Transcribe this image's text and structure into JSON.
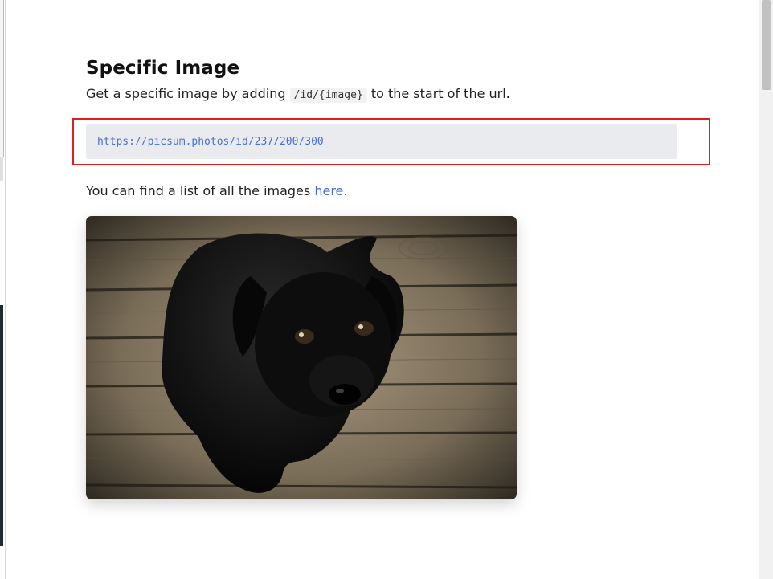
{
  "section": {
    "title": "Specific Image",
    "description_prefix": "Get a specific image by adding",
    "inline_code": "/id/{image}",
    "description_suffix": "to the start of the url.",
    "example_url": "https://picsum.photos/id/237/200/300",
    "list_text": "You can find a list of all the images",
    "list_link": "here."
  },
  "photo": {
    "subject": "black-puppy-on-wooden-floor"
  }
}
